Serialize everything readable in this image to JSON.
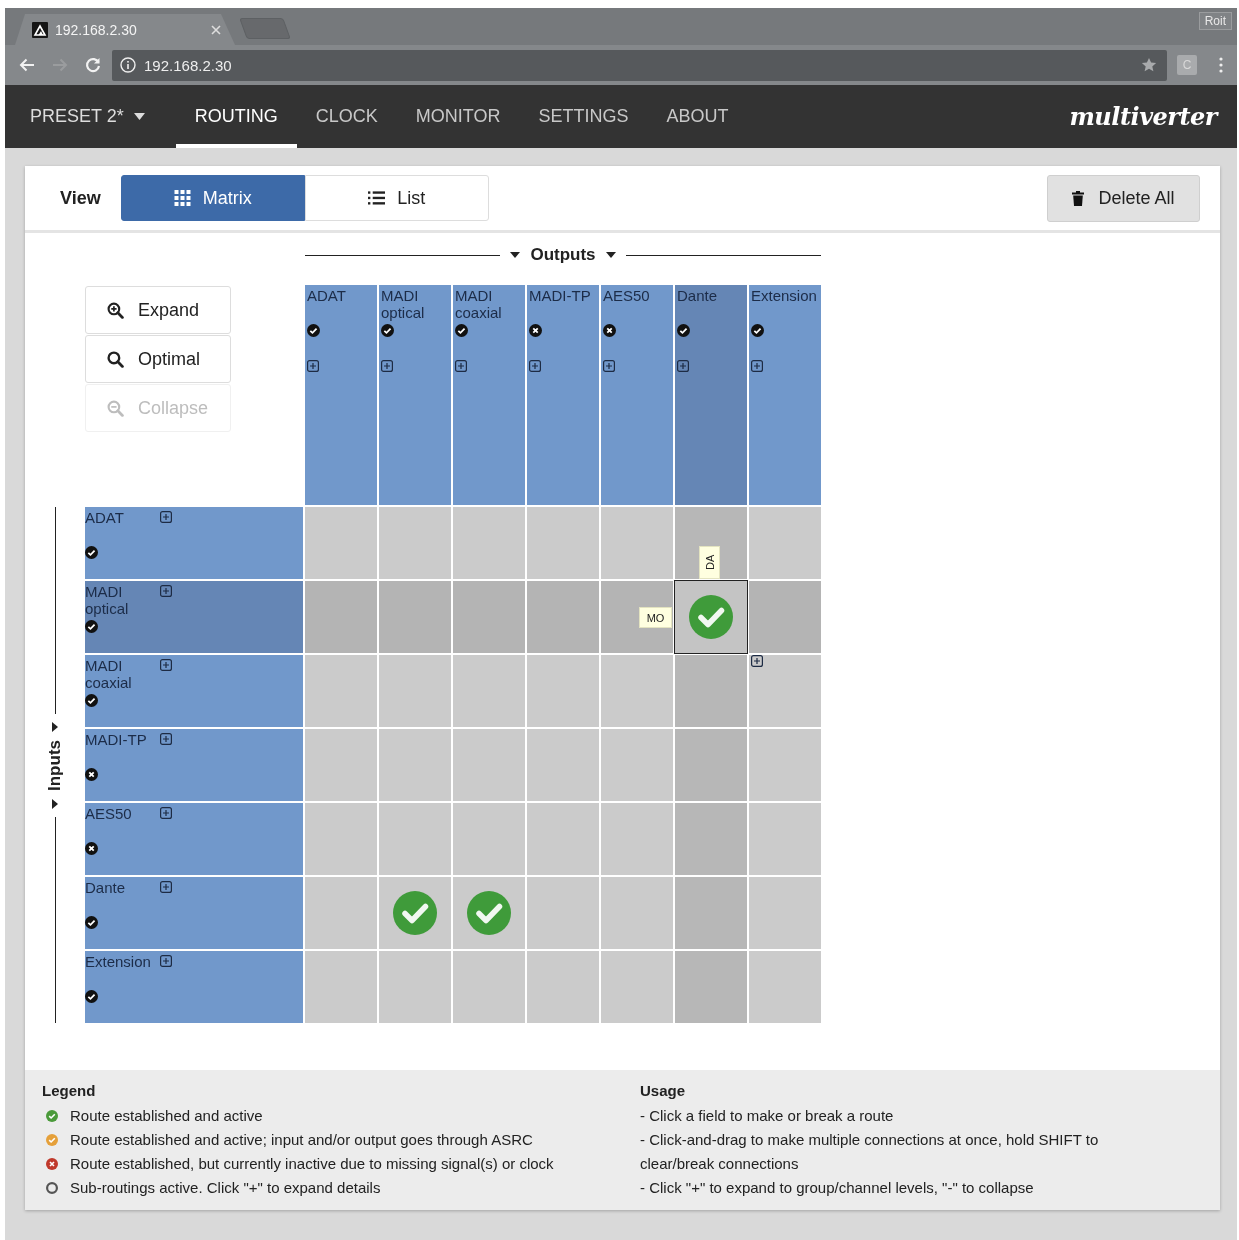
{
  "browser": {
    "tab_title": "192.168.2.30",
    "profile": "Roit",
    "url": "192.168.2.30",
    "extension": "C"
  },
  "nav": {
    "preset": "PRESET 2*",
    "tabs": [
      {
        "label": "ROUTING",
        "selected": true
      },
      {
        "label": "CLOCK",
        "selected": false
      },
      {
        "label": "MONITOR",
        "selected": false
      },
      {
        "label": "SETTINGS",
        "selected": false
      },
      {
        "label": "ABOUT",
        "selected": false
      }
    ],
    "logo": "multiverter"
  },
  "toolbar": {
    "view_label": "View",
    "views": [
      {
        "label": "Matrix",
        "kind": "matrix",
        "selected": true
      },
      {
        "label": "List",
        "kind": "list",
        "selected": false
      }
    ],
    "delete_button": "Delete All"
  },
  "zoom_buttons": [
    {
      "label": "Expand",
      "kind": "zoom-in",
      "disabled": false
    },
    {
      "label": "Optimal",
      "kind": "search",
      "disabled": false
    },
    {
      "label": "Collapse",
      "kind": "zoom-out",
      "disabled": true
    }
  ],
  "matrix": {
    "outputs_label": "Outputs",
    "inputs_label": "Inputs",
    "hover_tags": {
      "row": "MO",
      "column": "DA"
    },
    "columns": [
      {
        "name": "ADAT",
        "signal_ok": true,
        "selected": false
      },
      {
        "name": "MADI optical",
        "signal_ok": true,
        "selected": false
      },
      {
        "name": "MADI coaxial",
        "signal_ok": true,
        "selected": false
      },
      {
        "name": "MADI-TP",
        "signal_ok": false,
        "selected": false
      },
      {
        "name": "AES50",
        "signal_ok": false,
        "selected": false
      },
      {
        "name": "Dante",
        "signal_ok": true,
        "selected": true
      },
      {
        "name": "Extension",
        "signal_ok": true,
        "selected": false
      }
    ],
    "rows": [
      {
        "name": "ADAT",
        "signal_ok": true,
        "selected": false,
        "cells": [
          {
            "routed": false
          },
          {
            "routed": false
          },
          {
            "routed": false
          },
          {
            "routed": false
          },
          {
            "routed": false
          },
          {
            "routed": false
          },
          {
            "routed": false
          }
        ]
      },
      {
        "name": "MADI optical",
        "signal_ok": true,
        "selected": true,
        "cells": [
          {
            "routed": false
          },
          {
            "routed": false
          },
          {
            "routed": false
          },
          {
            "routed": false
          },
          {
            "routed": false
          },
          {
            "routed": true
          },
          {
            "routed": false
          }
        ]
      },
      {
        "name": "MADI coaxial",
        "signal_ok": true,
        "selected": false,
        "cells": [
          {
            "routed": false
          },
          {
            "routed": false
          },
          {
            "routed": false
          },
          {
            "routed": false
          },
          {
            "routed": false
          },
          {
            "routed": false
          },
          {
            "routed": false
          }
        ]
      },
      {
        "name": "MADI-TP",
        "signal_ok": false,
        "selected": false,
        "cells": [
          {
            "routed": false
          },
          {
            "routed": false
          },
          {
            "routed": false
          },
          {
            "routed": false
          },
          {
            "routed": false
          },
          {
            "routed": false
          },
          {
            "routed": false
          }
        ]
      },
      {
        "name": "AES50",
        "signal_ok": false,
        "selected": false,
        "cells": [
          {
            "routed": false
          },
          {
            "routed": false
          },
          {
            "routed": false
          },
          {
            "routed": false
          },
          {
            "routed": false
          },
          {
            "routed": false
          },
          {
            "routed": false
          }
        ]
      },
      {
        "name": "Dante",
        "signal_ok": true,
        "selected": false,
        "cells": [
          {
            "routed": false
          },
          {
            "routed": true
          },
          {
            "routed": true
          },
          {
            "routed": false
          },
          {
            "routed": false
          },
          {
            "routed": false
          },
          {
            "routed": false
          }
        ]
      },
      {
        "name": "Extension",
        "signal_ok": true,
        "selected": false,
        "cells": [
          {
            "routed": false
          },
          {
            "routed": false
          },
          {
            "routed": false
          },
          {
            "routed": false
          },
          {
            "routed": false
          },
          {
            "routed": false
          },
          {
            "routed": false
          }
        ]
      }
    ]
  },
  "legend": {
    "title": "Legend",
    "items": [
      {
        "kind": "active",
        "color": "#4a9a3a",
        "text": "Route established and active"
      },
      {
        "kind": "asrc",
        "color": "#e5a03a",
        "text": "Route established and active; input and/or output goes through ASRC"
      },
      {
        "kind": "inactive",
        "color": "#c0392b",
        "text": "Route established, but currently inactive due to missing signal(s) or clock"
      },
      {
        "kind": "sub",
        "color": "#555555",
        "text": "Sub-routings active. Click \"+\" to expand details"
      }
    ]
  },
  "usage": {
    "title": "Usage",
    "lines": [
      "- Click a field to make or break a route",
      "- Click-and-drag to make multiple connections at once, hold SHIFT to clear/break connections",
      "- Click \"+\" to expand to group/channel levels, \"-\" to collapse"
    ]
  }
}
